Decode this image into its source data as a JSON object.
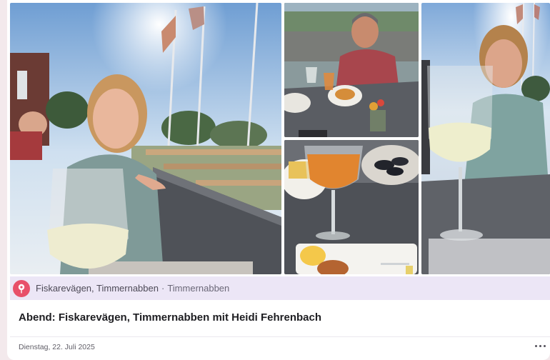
{
  "photos": [
    {
      "subject": "woman-with-wine-glass-flags"
    },
    {
      "subject": "man-at-table"
    },
    {
      "subject": "aperol-spritz-and-food"
    },
    {
      "subject": "woman-with-wine-glass-sunset"
    }
  ],
  "location": {
    "icon": "map-pin-icon",
    "icon_color": "#e8506a",
    "name": "Fiskarevägen, Timmernabben",
    "separator": "·",
    "region": "Timmernabben"
  },
  "memory": {
    "title": "Abend: Fiskarevägen, Timmernabben mit Heidi Fehrenbach",
    "date": "Dienstag, 22. Juli 2025"
  },
  "menu": {
    "icon": "more-options-icon"
  }
}
